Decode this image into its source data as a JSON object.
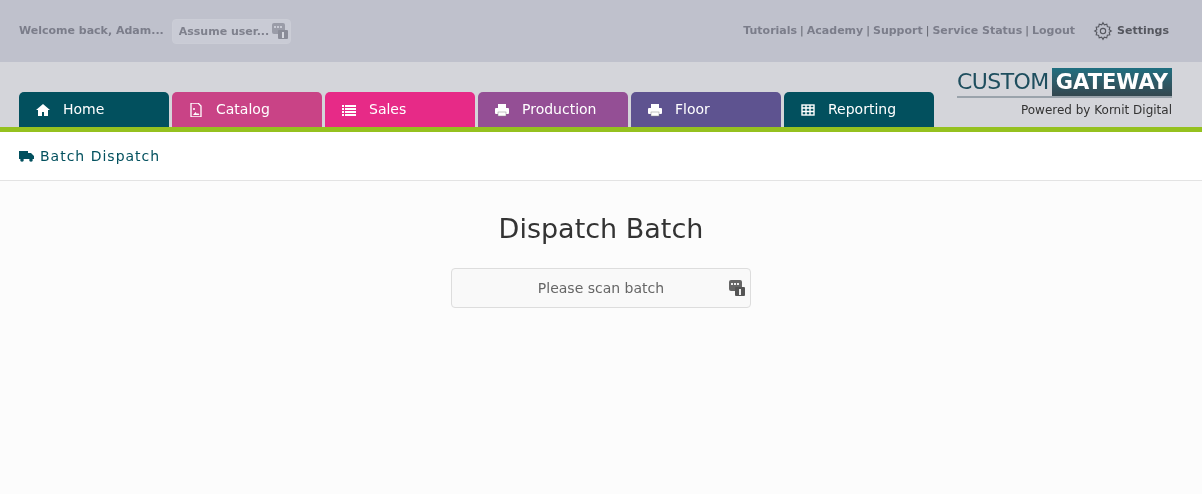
{
  "header": {
    "welcome": "Welcome back, Adam...",
    "assume_user": {
      "placeholder": "Assume user..."
    },
    "links": [
      {
        "kind": "link",
        "label": "Tutorials"
      },
      {
        "kind": "separator",
        "label": "|"
      },
      {
        "kind": "link",
        "label": "Academy"
      },
      {
        "kind": "separator",
        "label": "|"
      },
      {
        "kind": "link",
        "label": "Support"
      },
      {
        "kind": "separator",
        "label": "|"
      },
      {
        "kind": "link",
        "label": "Service Status"
      },
      {
        "kind": "separator",
        "label": "|"
      },
      {
        "kind": "link",
        "label": "Logout"
      }
    ],
    "settings": "Settings"
  },
  "tabs": [
    {
      "label": "Home",
      "color": "#02505e"
    },
    {
      "label": "Catalog",
      "color": "#c94386"
    },
    {
      "label": "Sales",
      "color": "#e72a87"
    },
    {
      "label": "Production",
      "color": "#944f95"
    },
    {
      "label": "Floor",
      "color": "#5e5390"
    },
    {
      "label": "Reporting",
      "color": "#02505e"
    }
  ],
  "logo": {
    "word_1": "CUSTOM",
    "word_2": "GATEWAY",
    "tagline": "Powered by Kornit Digital"
  },
  "breadcrumb": "Batch Dispatch",
  "main": {
    "title": "Dispatch Batch",
    "scan_field": {
      "placeholder": "Please scan batch"
    }
  }
}
